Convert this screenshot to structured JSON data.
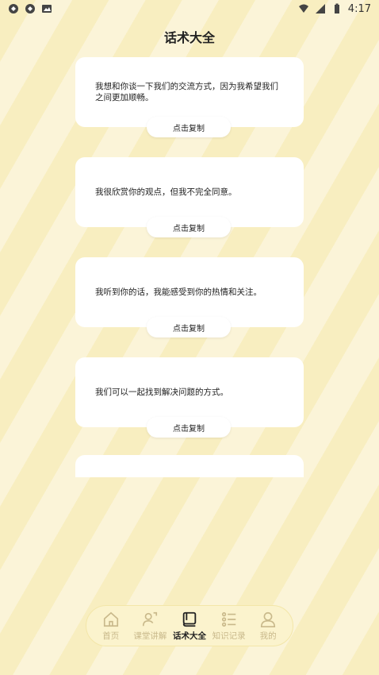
{
  "status_bar": {
    "time": "4:17"
  },
  "page": {
    "title": "话术大全"
  },
  "cards": [
    {
      "text": "我想和你谈一下我们的交流方式，因为我希望我们之间更加顺畅。",
      "button_label": "点击复制"
    },
    {
      "text": "我很欣赏你的观点，但我不完全同意。",
      "button_label": "点击复制"
    },
    {
      "text": "我听到你的话，我能感受到你的热情和关注。",
      "button_label": "点击复制"
    },
    {
      "text": "我们可以一起找到解决问题的方式。",
      "button_label": "点击复制"
    }
  ],
  "tabbar": {
    "items": [
      {
        "label": "首页",
        "icon": "home-icon",
        "active": false
      },
      {
        "label": "课堂讲解",
        "icon": "teacher-icon",
        "active": false
      },
      {
        "label": "话术大全",
        "icon": "book-icon",
        "active": true
      },
      {
        "label": "知识记录",
        "icon": "list-icon",
        "active": false
      },
      {
        "label": "我的",
        "icon": "user-icon",
        "active": false
      }
    ]
  },
  "colors": {
    "stripe_dark": "#f8eec0",
    "stripe_light": "#fbf4d8",
    "tab_inactive": "#c9b98b",
    "tab_active": "#222222"
  }
}
